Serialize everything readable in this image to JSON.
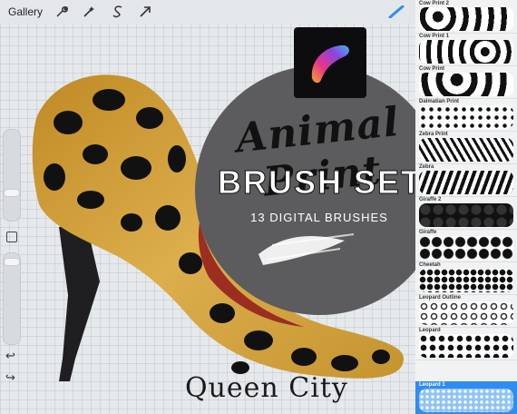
{
  "toolbar": {
    "gallery_label": "Gallery",
    "tools": [
      "wrench-icon",
      "magic-wand-icon",
      "selection-s-icon",
      "transform-arrow-icon"
    ],
    "brush_tool": "brush-icon",
    "accent_color": "#2f8cf0"
  },
  "promo": {
    "title_line1": "Animal Print",
    "title_line2": "BRUSH SET",
    "subtitle": "13 DIGITAL BRUSHES",
    "footer": "Queen City"
  },
  "brushes": [
    {
      "label": "Cow Print 2"
    },
    {
      "label": "Cow Print 1"
    },
    {
      "label": "Cow Print"
    },
    {
      "label": "Dalmatian Print"
    },
    {
      "label": "Zebra Print"
    },
    {
      "label": "Zebra"
    },
    {
      "label": "Giraffe 2"
    },
    {
      "label": "Giraffe"
    },
    {
      "label": "Cheetah"
    },
    {
      "label": "Leopard Outline"
    },
    {
      "label": "Leopard"
    },
    {
      "label": "Leopard 1"
    }
  ],
  "selected_brush": "Leopard 1",
  "colors": {
    "shoe": "#d4a23a",
    "heel": "#1f1f22",
    "sole": "#9c2d21",
    "circle": "#5c5c5e"
  }
}
